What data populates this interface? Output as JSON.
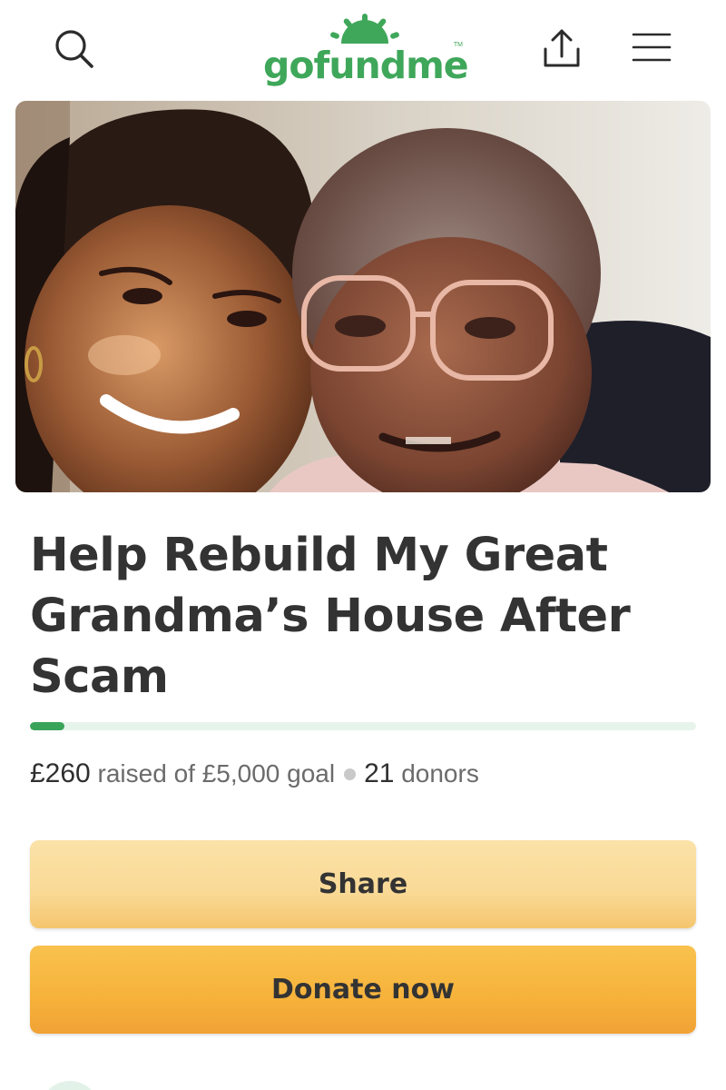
{
  "header": {
    "logo_text": "gofundme",
    "logo_tm": "TM",
    "icons": {
      "search": "search-icon",
      "share": "upload-share-icon",
      "menu": "hamburger-menu-icon"
    }
  },
  "campaign": {
    "title": "Help Rebuild My Great Grandma’s House After Scam",
    "raised_amount": "£260",
    "raised_text": "raised of £5,000 goal",
    "donors_count": "21",
    "donors_label": "donors",
    "progress_fraction": 0.052
  },
  "buttons": {
    "share_label": "Share",
    "donate_label": "Donate now"
  },
  "colors": {
    "brand_green": "#3fa75a",
    "progress_track": "#e6f4ec",
    "share_button": "#f9d995",
    "donate_button": "#f6b23b",
    "text_dark": "#333333",
    "text_muted": "#6b6b6b"
  }
}
